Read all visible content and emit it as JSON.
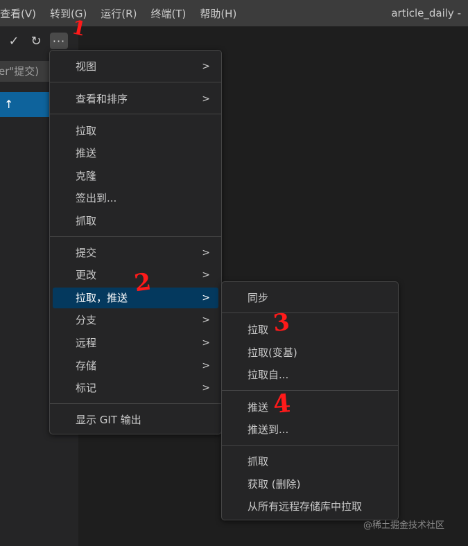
{
  "menubar": {
    "items": [
      "查看(V)",
      "转到(G)",
      "运行(R)",
      "终端(T)",
      "帮助(H)"
    ],
    "window_title": "article_daily -"
  },
  "scm": {
    "commit_placeholder": "er\"提交)",
    "commit_button_icon": "↑",
    "toolbar_icons": [
      "check-icon",
      "refresh-icon",
      "more-icon"
    ]
  },
  "main_menu": {
    "items": [
      {
        "label": "视图",
        "submenu": true
      },
      {
        "label": "查看和排序",
        "submenu": true
      },
      {
        "label": "拉取",
        "submenu": false
      },
      {
        "label": "推送",
        "submenu": false
      },
      {
        "label": "克隆",
        "submenu": false
      },
      {
        "label": "签出到...",
        "submenu": false
      },
      {
        "label": "抓取",
        "submenu": false
      },
      {
        "label": "提交",
        "submenu": true
      },
      {
        "label": "更改",
        "submenu": true
      },
      {
        "label": "拉取，推送",
        "submenu": true,
        "active": true
      },
      {
        "label": "分支",
        "submenu": true
      },
      {
        "label": "远程",
        "submenu": true
      },
      {
        "label": "存储",
        "submenu": true
      },
      {
        "label": "标记",
        "submenu": true
      },
      {
        "label": "显示 GIT 输出",
        "submenu": false
      }
    ]
  },
  "sub_menu": {
    "items": [
      {
        "label": "同步"
      },
      {
        "label": "拉取"
      },
      {
        "label": "拉取(变基)"
      },
      {
        "label": "拉取自..."
      },
      {
        "label": "推送"
      },
      {
        "label": "推送到..."
      },
      {
        "label": "抓取"
      },
      {
        "label": "获取 (删除)"
      },
      {
        "label": "从所有远程存储库中拉取"
      }
    ]
  },
  "annotations": [
    "1",
    "2",
    "3",
    "4"
  ],
  "annotation_color": "#ff1a1a",
  "accent_color": "#0e639c",
  "highlight_color": "#04395e",
  "watermark": "@稀土掘金技术社区"
}
